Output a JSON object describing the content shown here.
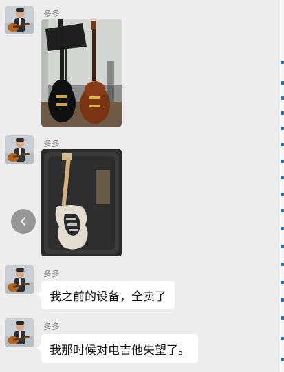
{
  "chat": {
    "messages": [
      {
        "sender": "多多",
        "type": "image",
        "image_desc": "two-guitars-photo"
      },
      {
        "sender": "多多",
        "type": "image",
        "image_desc": "guitar-in-case-photo"
      },
      {
        "sender": "多多",
        "type": "text",
        "text": "我之前的设备，全卖了"
      },
      {
        "sender": "多多",
        "type": "text",
        "text": "我那时候对电吉他失望了。"
      }
    ]
  },
  "controls": {
    "prev_icon": "chevron-left-icon"
  },
  "colors": {
    "background": "#ededed",
    "bubble": "#ffffff",
    "sender_name": "#8a8a8a",
    "nav_button": "#787878"
  }
}
